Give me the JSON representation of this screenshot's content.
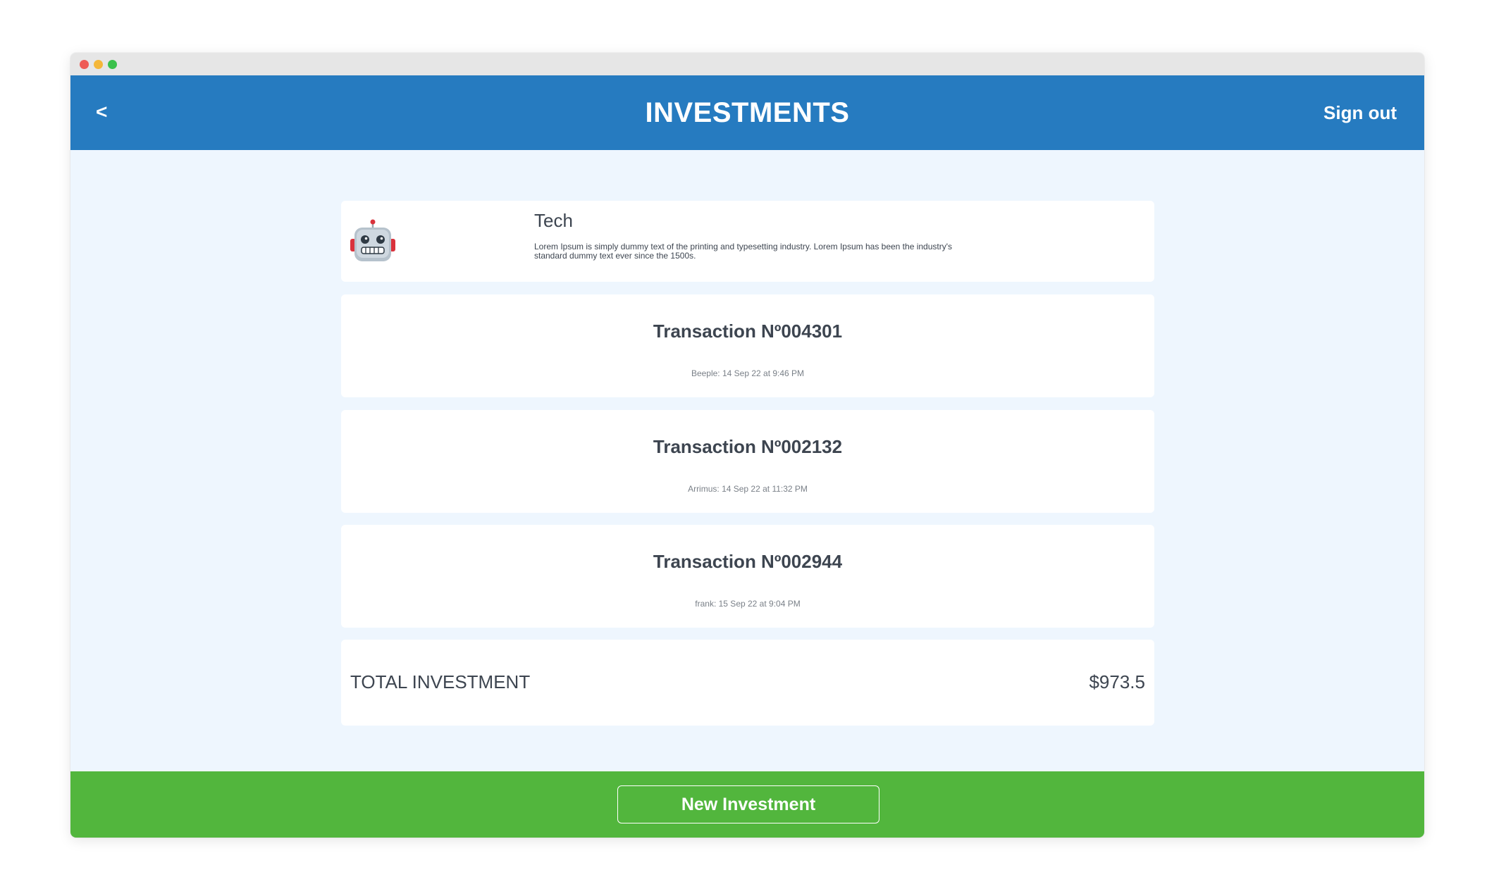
{
  "header": {
    "back_label": "<",
    "title": "INVESTMENTS",
    "sign_out_label": "Sign out"
  },
  "category": {
    "icon": "robot-icon",
    "name": "Tech",
    "description": "Lorem Ipsum is simply dummy text of the printing and typesetting industry. Lorem Ipsum has been the industry's standard dummy text ever since the 1500s."
  },
  "transactions": [
    {
      "title": "Transaction Nº004301",
      "meta": "Beeple: 14 Sep 22 at 9:46 PM"
    },
    {
      "title": "Transaction Nº002132",
      "meta": "Arrimus: 14 Sep 22 at 11:32 PM"
    },
    {
      "title": "Transaction Nº002944",
      "meta": "frank: 15 Sep 22 at 9:04 PM"
    }
  ],
  "total": {
    "label": "TOTAL INVESTMENT",
    "value": "$973.5"
  },
  "footer": {
    "new_investment_label": "New Investment"
  },
  "colors": {
    "header_bg": "#267bc0",
    "content_bg": "#eef6fe",
    "footer_bg": "#52b63d",
    "text_dark": "#3d4550"
  }
}
